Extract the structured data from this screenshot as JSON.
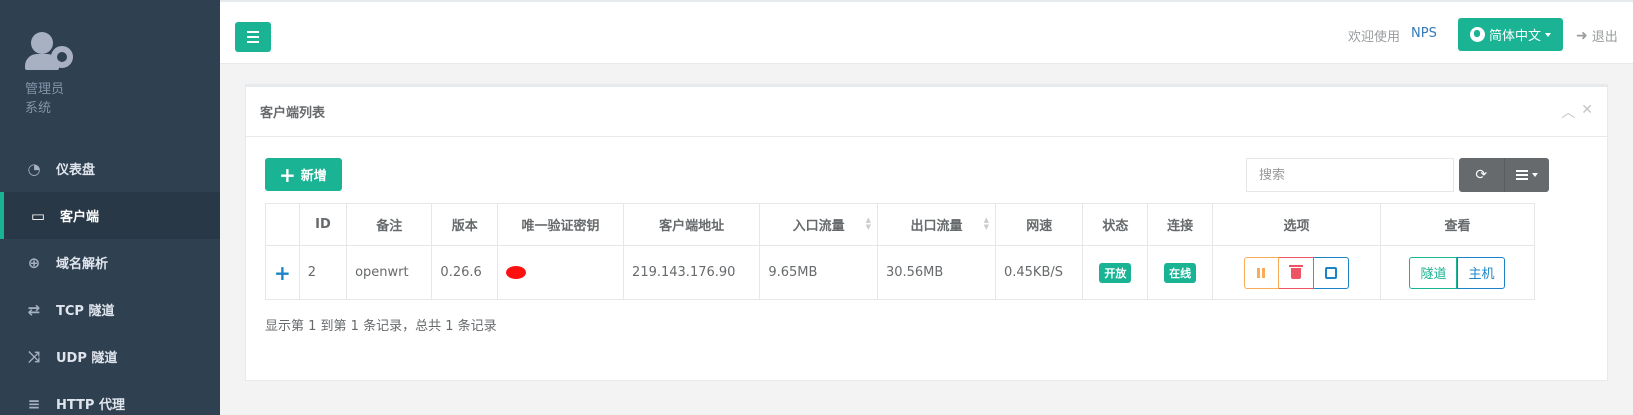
{
  "sidebar": {
    "profile": {
      "role": "管理员",
      "sub": "系统"
    },
    "items": [
      {
        "label": "仪表盘",
        "icon": "dashboard-icon",
        "glyph": "◔",
        "active": false
      },
      {
        "label": "客户端",
        "icon": "desktop-icon",
        "glyph": "▭",
        "active": true
      },
      {
        "label": "域名解析",
        "icon": "globe-icon",
        "glyph": "⊕",
        "active": false
      },
      {
        "label": "TCP 隧道",
        "icon": "retweet-icon",
        "glyph": "⇄",
        "active": false
      },
      {
        "label": "UDP 隧道",
        "icon": "random-icon",
        "glyph": "⤨",
        "active": false
      },
      {
        "label": "HTTP 代理",
        "icon": "server-icon",
        "glyph": "≡",
        "active": false
      }
    ]
  },
  "header": {
    "welcome": "欢迎使用",
    "brand": "NPS",
    "language": "简体中文",
    "logout": "退出"
  },
  "panel": {
    "title": "客户端列表",
    "add_label": "新增",
    "search_placeholder": "搜索",
    "columns": [
      "ID",
      "备注",
      "版本",
      "唯一验证密钥",
      "客户端地址",
      "入口流量",
      "出口流量",
      "网速",
      "状态",
      "连接",
      "选项",
      "查看"
    ],
    "rows": [
      {
        "id": "2",
        "remark": "openwrt",
        "version": "0.26.6",
        "key": "",
        "address": "219.143.176.90",
        "in_flow": "9.65MB",
        "out_flow": "30.56MB",
        "speed": "0.45KB/S",
        "status": "开放",
        "connect": "在线",
        "view_tunnel": "隧道",
        "view_host": "主机"
      }
    ],
    "footer": "显示第 1 到第 1 条记录，总共 1 条记录"
  },
  "colors": {
    "sidebar_bg": "#2f4050",
    "primary": "#1ab394",
    "info": "#1c84c6",
    "warning": "#f8ac59",
    "danger": "#ed5565"
  }
}
